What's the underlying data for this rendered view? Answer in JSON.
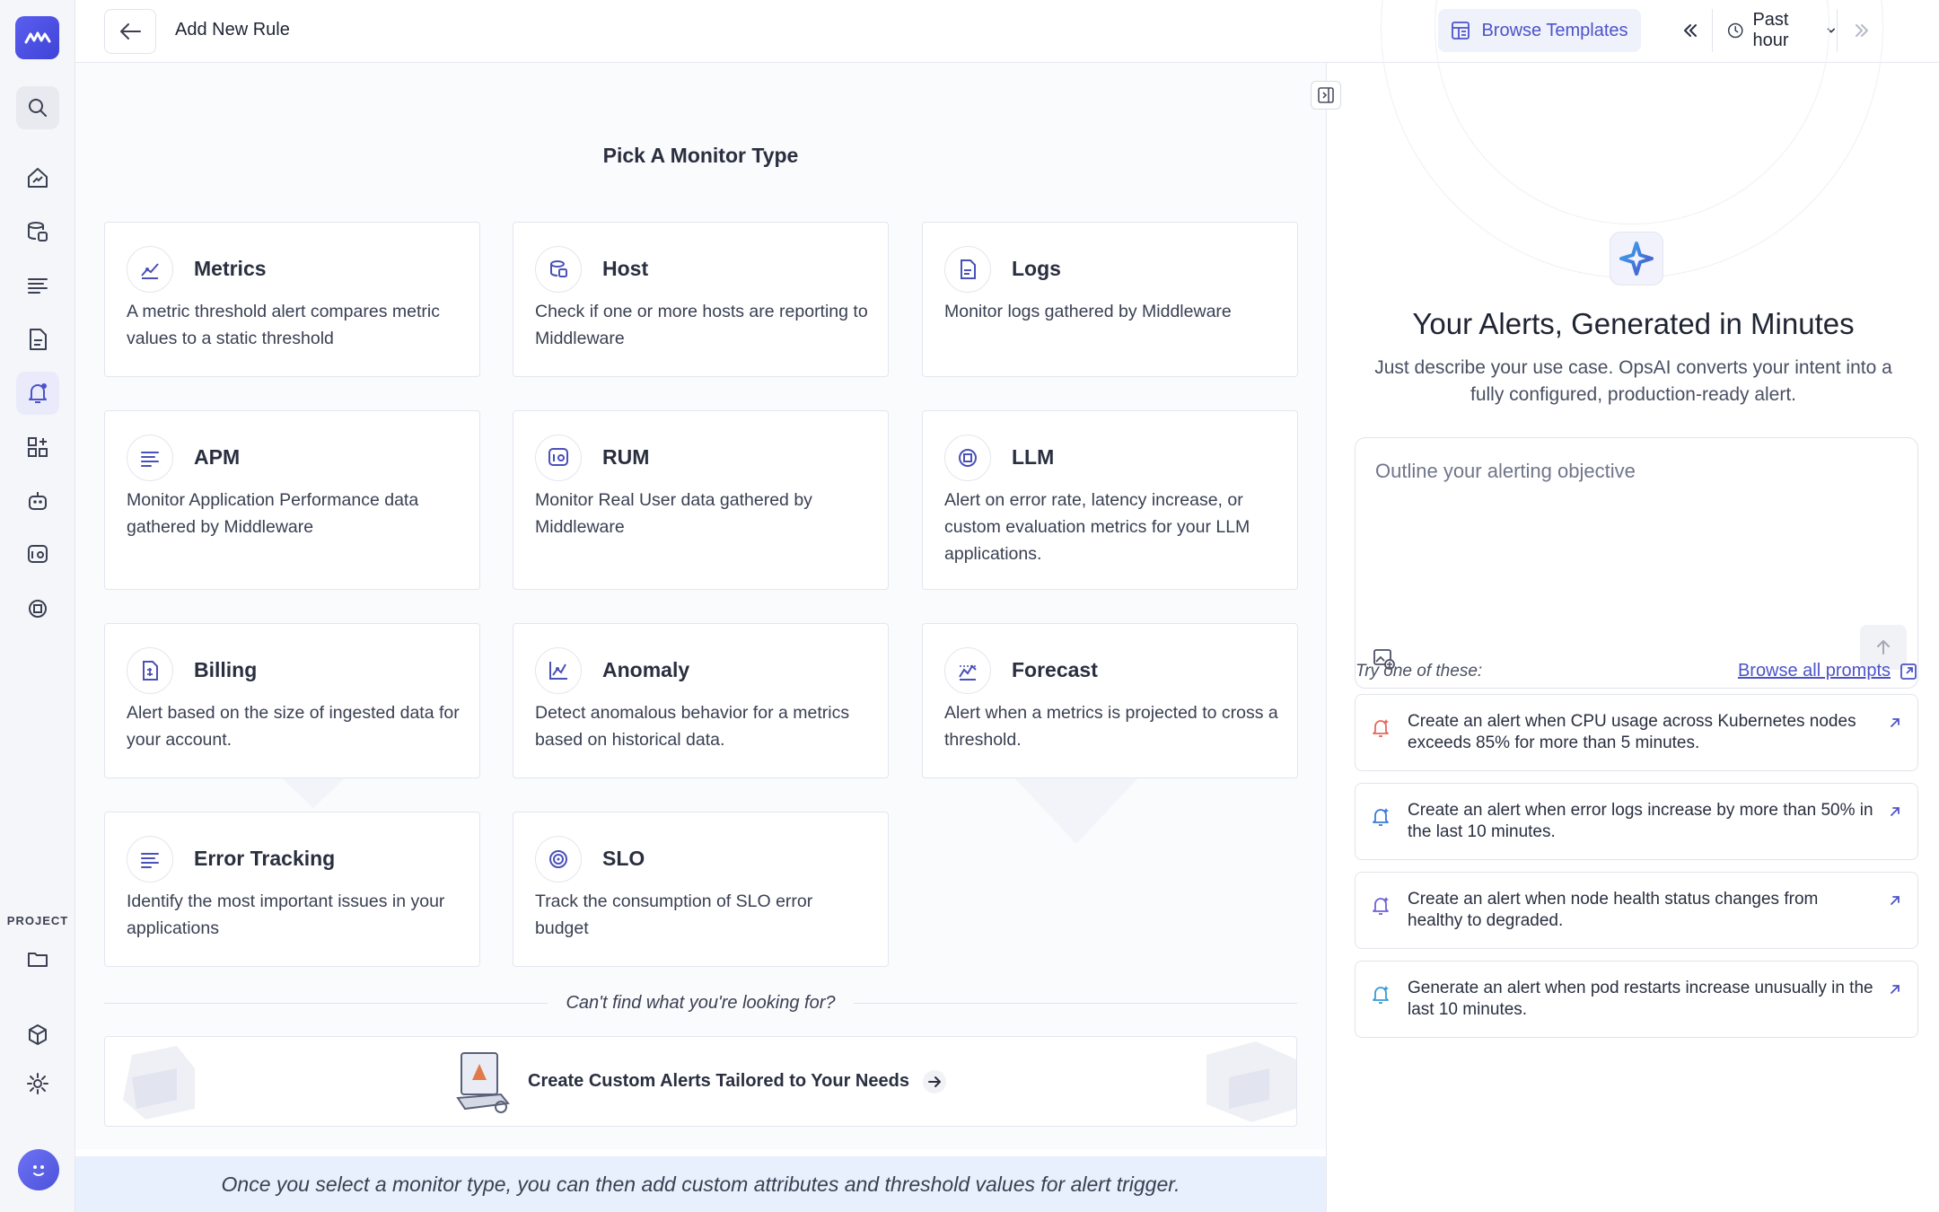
{
  "header": {
    "title": "Add New Rule",
    "browse_templates": "Browse Templates",
    "time_range": "Past hour"
  },
  "sidebar": {
    "project_label": "PROJECT"
  },
  "main": {
    "heading": "Pick A Monitor Type",
    "cards": [
      {
        "title": "Metrics",
        "desc": "A metric threshold alert compares metric values to a static threshold",
        "icon": "metrics-icon"
      },
      {
        "title": "Host",
        "desc": "Check if one or more hosts are reporting to Middleware",
        "icon": "host-icon"
      },
      {
        "title": "Logs",
        "desc": "Monitor logs gathered by Middleware",
        "icon": "logs-icon"
      },
      {
        "title": "APM",
        "desc": "Monitor Application Performance data gathered by Middleware",
        "icon": "apm-icon"
      },
      {
        "title": "RUM",
        "desc": "Monitor Real User data gathered by Middleware",
        "icon": "rum-icon"
      },
      {
        "title": "LLM",
        "desc": "Alert on error rate, latency increase, or custom evaluation metrics for your LLM applications.",
        "icon": "llm-icon"
      },
      {
        "title": "Billing",
        "desc": "Alert based on the size of ingested data for your account.",
        "icon": "billing-icon"
      },
      {
        "title": "Anomaly",
        "desc": "Detect anomalous behavior for a metrics based on historical data.",
        "icon": "anomaly-icon"
      },
      {
        "title": "Forecast",
        "desc": "Alert when a metrics is projected to cross a threshold.",
        "icon": "forecast-icon"
      },
      {
        "title": "Error Tracking",
        "desc": "Identify the most important issues in your applications",
        "icon": "error-tracking-icon"
      },
      {
        "title": "SLO",
        "desc": "Track the consumption of SLO error budget",
        "icon": "slo-icon"
      }
    ],
    "cant_find": "Can't find what you're looking for?",
    "custom_alerts": "Create Custom Alerts Tailored to Your Needs",
    "footer_hint": "Once you select a monitor type, you can then add custom attributes and threshold values for alert trigger."
  },
  "ai_panel": {
    "title": "Your Alerts, Generated in Minutes",
    "subtitle": "Just describe your use case. OpsAI converts your intent into a fully configured, production-ready alert.",
    "placeholder": "Outline your alerting objective",
    "try_label": "Try one of these:",
    "browse_all": "Browse all prompts",
    "suggestions": [
      {
        "text": "Create an alert when CPU usage across Kubernetes nodes exceeds 85% for more than 5 minutes.",
        "color": "#e46a5a"
      },
      {
        "text": "Create an alert when error logs increase by more than 50% in the last 10 minutes.",
        "color": "#3a7bd5"
      },
      {
        "text": "Create an alert when node health status changes from healthy to degraded.",
        "color": "#6b62d8"
      },
      {
        "text": "Generate an alert when pod restarts increase unusually in the last 10 minutes.",
        "color": "#3a9bd5"
      }
    ]
  },
  "colors": {
    "accent": "#4c53c9",
    "brand": "#4f54e0",
    "icon": "#4a51b8"
  }
}
